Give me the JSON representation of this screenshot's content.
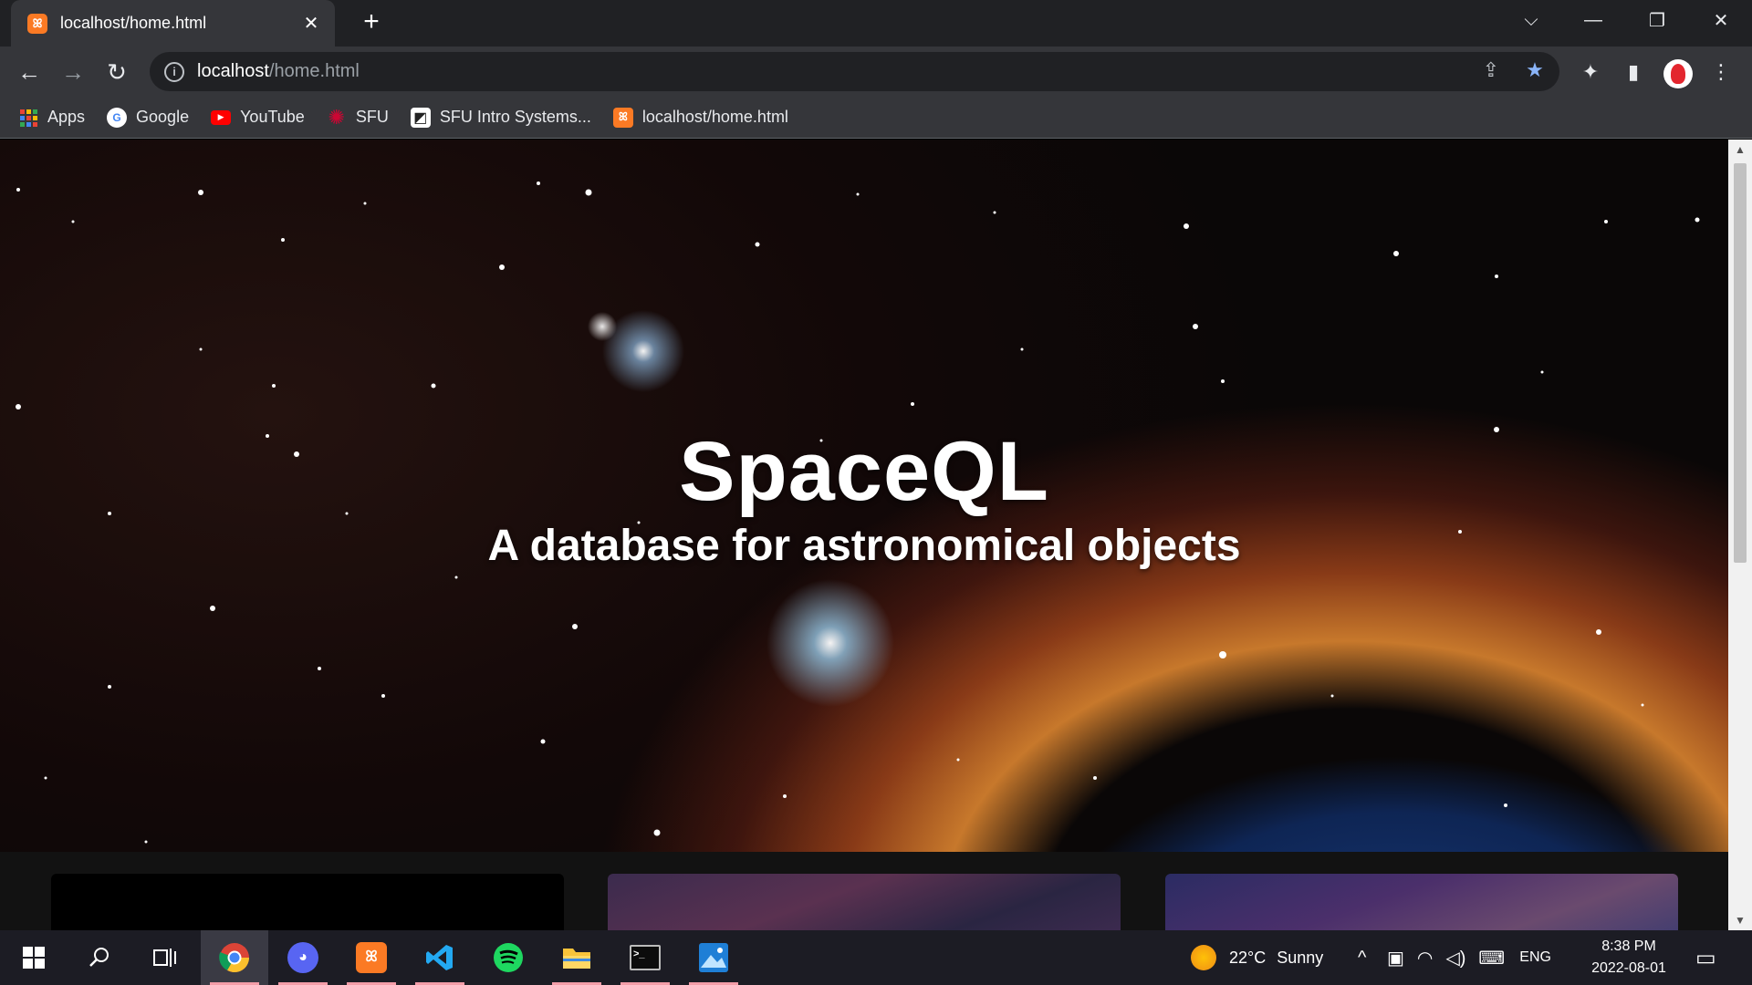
{
  "browser": {
    "tab": {
      "title": "localhost/home.html",
      "favicon_text": "ꕤ",
      "close_glyph": "✕"
    },
    "new_tab_glyph": "+",
    "window_controls": {
      "tab_search": "⌵",
      "minimize": "—",
      "restore": "❐",
      "close": "✕"
    },
    "toolbar": {
      "back": "←",
      "forward": "→",
      "reload": "↻",
      "url_host": "localhost",
      "url_path": "/home.html",
      "info": "i",
      "share": "⇪",
      "bookmark_star": "★",
      "extensions": "✦",
      "side_panel": "▮",
      "menu": "⋮"
    },
    "bookmarks": [
      {
        "label": "Apps",
        "icon": "apps-grid"
      },
      {
        "label": "Google",
        "icon": "G"
      },
      {
        "label": "YouTube",
        "icon": "▶"
      },
      {
        "label": "SFU",
        "icon": "✺"
      },
      {
        "label": "SFU Intro Systems...",
        "icon": "◩"
      },
      {
        "label": "localhost/home.html",
        "icon": "ꕤ"
      }
    ]
  },
  "page": {
    "title": "SpaceQL",
    "subtitle": "A database for astronomical objects"
  },
  "scrollbar": {
    "up": "▲",
    "down": "▼"
  },
  "taskbar": {
    "weather_temp": "22°C",
    "weather_desc": "Sunny",
    "language": "ENG",
    "time": "8:38 PM",
    "date": "2022-08-01",
    "chevron": "^",
    "apps": [
      "start",
      "search",
      "task-view",
      "chrome",
      "discord",
      "xampp",
      "vscode",
      "spotify",
      "file-explorer",
      "terminal",
      "photos"
    ]
  },
  "colors": {
    "tab_active": "#35363a",
    "tabstrip": "#202124",
    "xampp_orange": "#fb7a24",
    "bookmark_star": "#8ab4f8",
    "taskbar_underline": "#f39da8"
  }
}
